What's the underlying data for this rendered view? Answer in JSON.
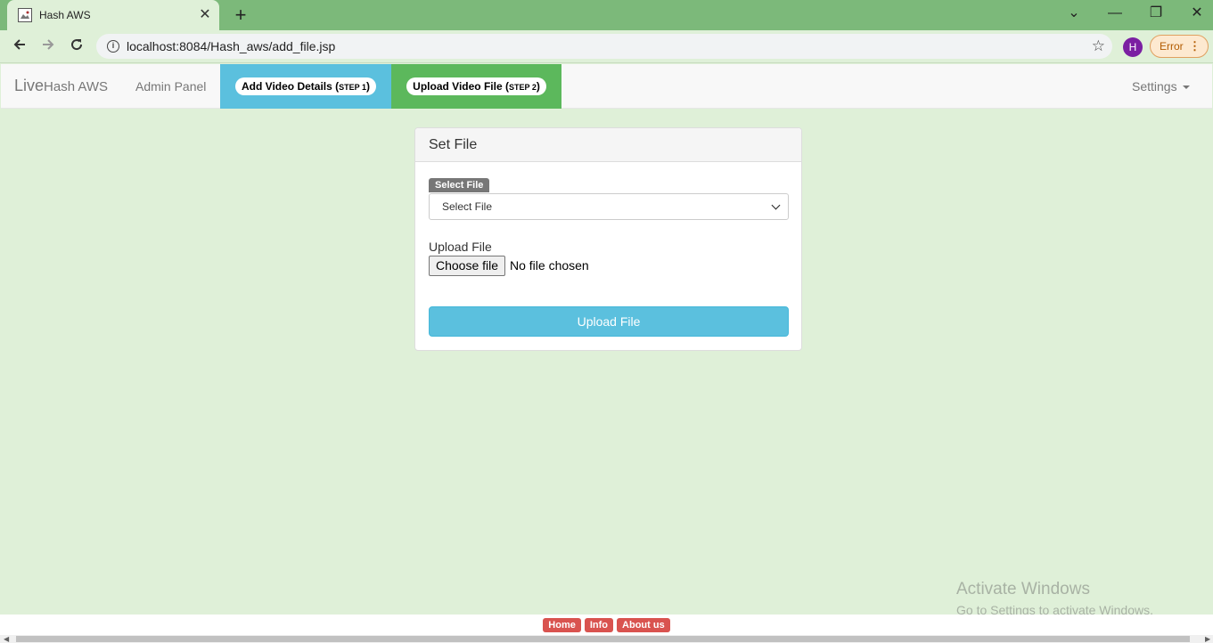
{
  "browser": {
    "tab_title": "Hash AWS",
    "tab_close": "✕",
    "new_tab": "+",
    "url": "localhost:8084/Hash_aws/add_file.jsp",
    "profile_initial": "H",
    "error_label": "Error",
    "window_controls": {
      "tabs_menu": "⌄",
      "minimize": "—",
      "restore": "❐",
      "close": "✕"
    }
  },
  "navbar": {
    "brand_live": "Live",
    "brand_rest": "Hash AWS",
    "admin_panel": "Admin Panel",
    "step1_label": "Add Video Details (",
    "step1_small": "STEP 1",
    "step2_label": "Upload Video File (",
    "step2_small": "STEP 2",
    "step_close": ")",
    "settings": "Settings"
  },
  "panel": {
    "heading": "Set File",
    "select_tag": "Select File",
    "select_value": "Select File",
    "upload_label": "Upload File",
    "choose_button": "Choose file",
    "no_file_text": "No file chosen",
    "upload_button": "Upload File"
  },
  "watermark": {
    "title": "Activate Windows",
    "subtitle": "Go to Settings to activate Windows."
  },
  "footer": {
    "links": [
      "Home",
      "Info",
      "About us"
    ]
  },
  "colors": {
    "page_bg": "#dff0d8",
    "tabstrip": "#7cb97a",
    "info_blue": "#5bc0de",
    "success_green": "#5cb85c",
    "danger_red": "#d9534f"
  }
}
